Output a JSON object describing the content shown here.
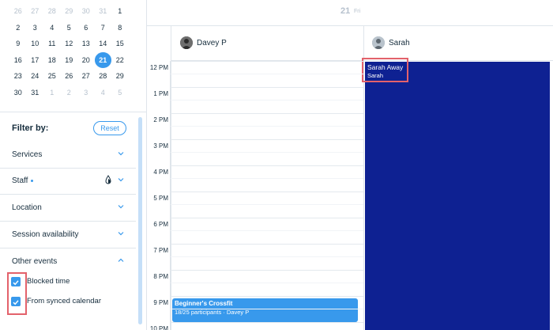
{
  "mini_calendar": {
    "weeks": [
      [
        {
          "d": "26",
          "m": true
        },
        {
          "d": "27",
          "m": true
        },
        {
          "d": "28",
          "m": true
        },
        {
          "d": "29",
          "m": true
        },
        {
          "d": "30",
          "m": true
        },
        {
          "d": "31",
          "m": true
        },
        {
          "d": "1",
          "m": false
        }
      ],
      [
        {
          "d": "2",
          "m": false
        },
        {
          "d": "3",
          "m": false
        },
        {
          "d": "4",
          "m": false
        },
        {
          "d": "5",
          "m": false
        },
        {
          "d": "6",
          "m": false
        },
        {
          "d": "7",
          "m": false
        },
        {
          "d": "8",
          "m": false
        }
      ],
      [
        {
          "d": "9",
          "m": false
        },
        {
          "d": "10",
          "m": false
        },
        {
          "d": "11",
          "m": false
        },
        {
          "d": "12",
          "m": false
        },
        {
          "d": "13",
          "m": false
        },
        {
          "d": "14",
          "m": false
        },
        {
          "d": "15",
          "m": false
        }
      ],
      [
        {
          "d": "16",
          "m": false
        },
        {
          "d": "17",
          "m": false
        },
        {
          "d": "18",
          "m": false
        },
        {
          "d": "19",
          "m": false
        },
        {
          "d": "20",
          "m": false
        },
        {
          "d": "21",
          "m": false,
          "s": true
        },
        {
          "d": "22",
          "m": false
        }
      ],
      [
        {
          "d": "23",
          "m": false
        },
        {
          "d": "24",
          "m": false
        },
        {
          "d": "25",
          "m": false
        },
        {
          "d": "26",
          "m": false
        },
        {
          "d": "27",
          "m": false
        },
        {
          "d": "28",
          "m": false
        },
        {
          "d": "29",
          "m": false
        }
      ],
      [
        {
          "d": "30",
          "m": false
        },
        {
          "d": "31",
          "m": false
        },
        {
          "d": "1",
          "m": true
        },
        {
          "d": "2",
          "m": true
        },
        {
          "d": "3",
          "m": true
        },
        {
          "d": "4",
          "m": true
        },
        {
          "d": "5",
          "m": true
        }
      ]
    ]
  },
  "filter": {
    "title": "Filter by:",
    "reset_label": "Reset",
    "sections": {
      "services": "Services",
      "staff": "Staff",
      "location": "Location",
      "session_availability": "Session availability",
      "other_events": "Other events"
    },
    "checkboxes": {
      "blocked_time": "Blocked time",
      "synced_calendar": "From synced calendar"
    }
  },
  "calendar": {
    "date_number": "21",
    "date_dow": "Fri",
    "staff": {
      "davey": "Davey P",
      "sarah": "Sarah"
    },
    "times": [
      "12 PM",
      "1 PM",
      "2 PM",
      "3 PM",
      "4 PM",
      "5 PM",
      "6 PM",
      "7 PM",
      "8 PM",
      "9 PM",
      "10 PM"
    ],
    "away_event": {
      "title": "Sarah Away",
      "subtitle": "Sarah"
    },
    "class_event": {
      "title": "Beginner's Crossfit",
      "subtitle": "18/25 participants · Davey P"
    }
  },
  "colors": {
    "accent": "#3899ec",
    "away_block": "#0e2192",
    "highlight": "#e3626b"
  }
}
